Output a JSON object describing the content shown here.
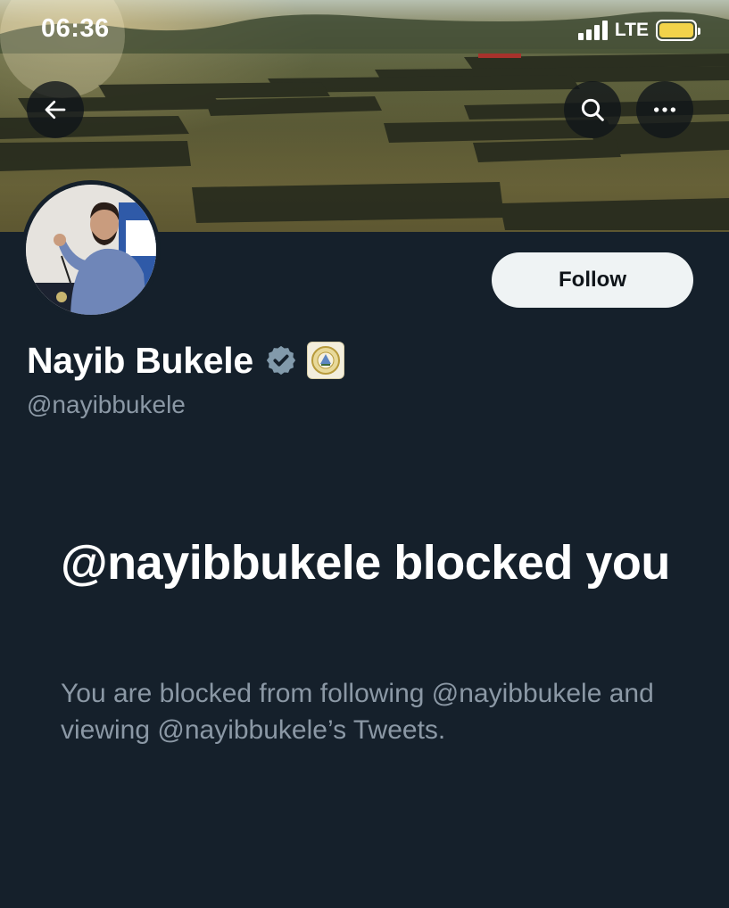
{
  "status_bar": {
    "time": "06:36",
    "network": "LTE",
    "signal_bars": 4,
    "battery_color": "#f2d34a"
  },
  "header": {
    "back_icon": "arrow-left-icon",
    "search_icon": "search-icon",
    "more_icon": "more-horizontal-icon"
  },
  "profile": {
    "display_name": "Nayib Bukele",
    "handle": "@nayibbukele",
    "verified_badge_color": "#829aab",
    "follow_label": "Follow"
  },
  "blocked": {
    "title": "@nayibbukele blocked you",
    "description": "You are blocked from following @nayibbukele and viewing @nayibbukele’s Tweets."
  },
  "colors": {
    "background": "#15202b",
    "secondary_text": "#8b98a5",
    "button_bg": "#eff3f4"
  }
}
